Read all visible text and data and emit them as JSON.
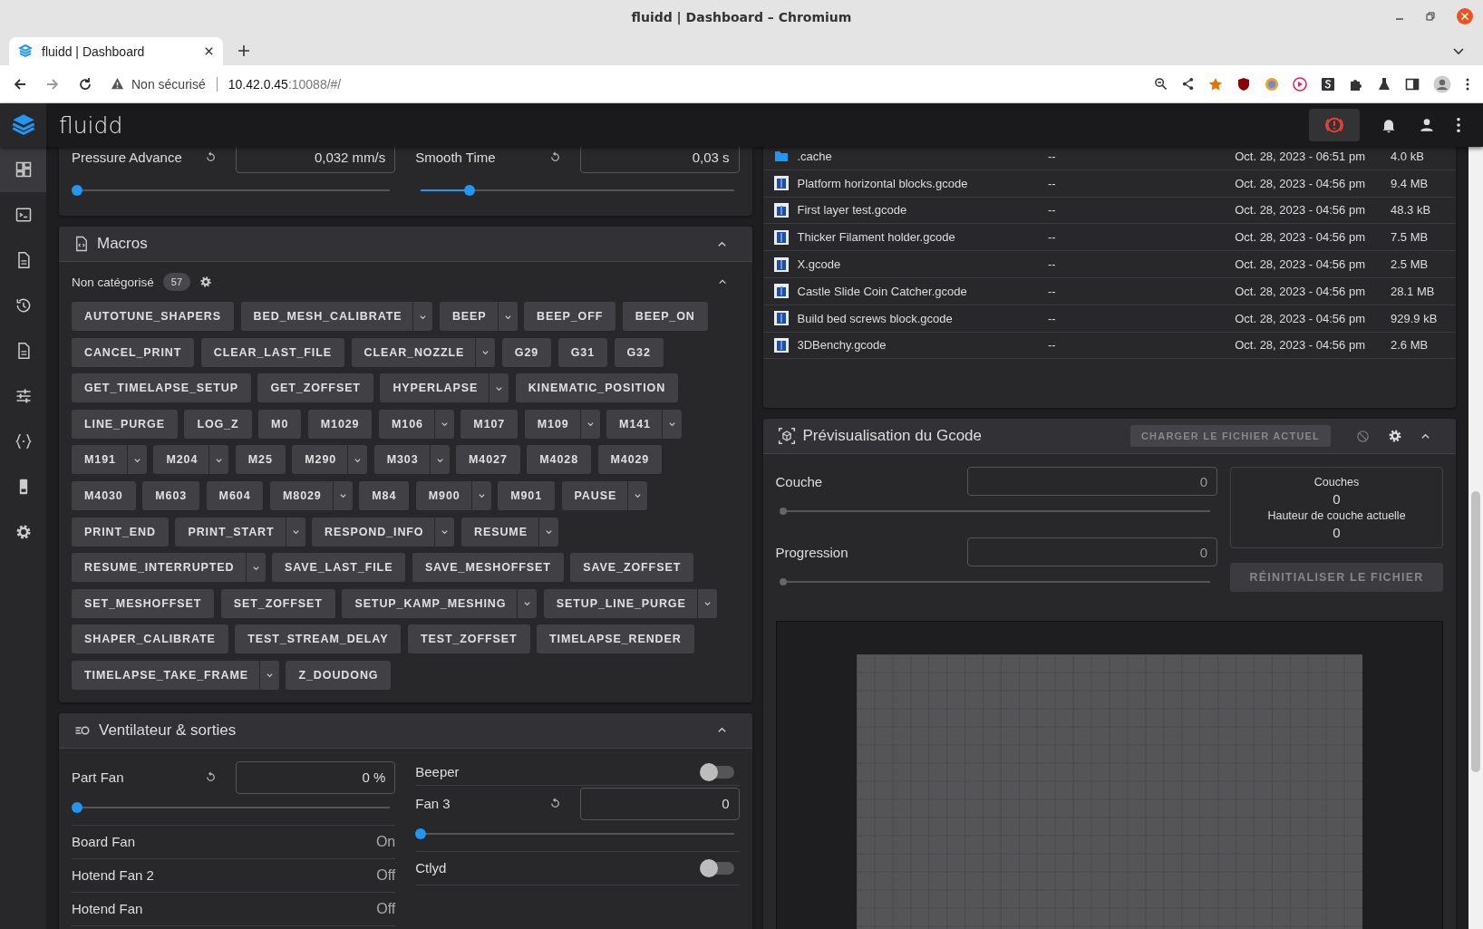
{
  "browser": {
    "window_title": "fluidd | Dashboard – Chromium",
    "tab_title": "fluidd | Dashboard",
    "security_label": "Non sécurisé",
    "url_host": "10.42.0.45",
    "url_rest": ":10088/#/"
  },
  "app": {
    "name": "fluidd"
  },
  "sidebar": {
    "items": [
      {
        "kind": "dashboard",
        "selected": true
      },
      {
        "kind": "console",
        "selected": false
      },
      {
        "kind": "file",
        "selected": false
      },
      {
        "kind": "history",
        "selected": false
      },
      {
        "kind": "document",
        "selected": false
      },
      {
        "kind": "tune",
        "selected": false
      },
      {
        "kind": "braces",
        "selected": false
      },
      {
        "kind": "device",
        "selected": false
      },
      {
        "kind": "settings",
        "selected": false
      }
    ]
  },
  "tuning": [
    {
      "label": "Pressure Advance",
      "value": "0,032 mm/s",
      "level": 0
    },
    {
      "label": "Smooth Time",
      "value": "0,03 s",
      "level": 0.15
    }
  ],
  "macros": {
    "title": "Macros",
    "category": "Non catégorisé",
    "count": "57",
    "items": [
      {
        "name": "AUTOTUNE_SHAPERS",
        "has_menu": false
      },
      {
        "name": "BED_MESH_CALIBRATE",
        "has_menu": true
      },
      {
        "name": "BEEP",
        "has_menu": true
      },
      {
        "name": "BEEP_OFF",
        "has_menu": false
      },
      {
        "name": "BEEP_ON",
        "has_menu": false
      },
      {
        "name": "CANCEL_PRINT",
        "has_menu": false
      },
      {
        "name": "CLEAR_LAST_FILE",
        "has_menu": false
      },
      {
        "name": "CLEAR_NOZZLE",
        "has_menu": true
      },
      {
        "name": "G29",
        "has_menu": false
      },
      {
        "name": "G31",
        "has_menu": false
      },
      {
        "name": "G32",
        "has_menu": false
      },
      {
        "name": "GET_TIMELAPSE_SETUP",
        "has_menu": false
      },
      {
        "name": "GET_ZOFFSET",
        "has_menu": false
      },
      {
        "name": "HYPERLAPSE",
        "has_menu": true
      },
      {
        "name": "KINEMATIC_POSITION",
        "has_menu": false
      },
      {
        "name": "LINE_PURGE",
        "has_menu": false
      },
      {
        "name": "LOG_Z",
        "has_menu": false
      },
      {
        "name": "M0",
        "has_menu": false
      },
      {
        "name": "M1029",
        "has_menu": false
      },
      {
        "name": "M106",
        "has_menu": true
      },
      {
        "name": "M107",
        "has_menu": false
      },
      {
        "name": "M109",
        "has_menu": true
      },
      {
        "name": "M141",
        "has_menu": true
      },
      {
        "name": "M191",
        "has_menu": true
      },
      {
        "name": "M204",
        "has_menu": true
      },
      {
        "name": "M25",
        "has_menu": false
      },
      {
        "name": "M290",
        "has_menu": true
      },
      {
        "name": "M303",
        "has_menu": true
      },
      {
        "name": "M4027",
        "has_menu": false
      },
      {
        "name": "M4028",
        "has_menu": false
      },
      {
        "name": "M4029",
        "has_menu": false
      },
      {
        "name": "M4030",
        "has_menu": false
      },
      {
        "name": "M603",
        "has_menu": false
      },
      {
        "name": "M604",
        "has_menu": false
      },
      {
        "name": "M8029",
        "has_menu": true
      },
      {
        "name": "M84",
        "has_menu": false
      },
      {
        "name": "M900",
        "has_menu": true
      },
      {
        "name": "M901",
        "has_menu": false
      },
      {
        "name": "PAUSE",
        "has_menu": true
      },
      {
        "name": "PRINT_END",
        "has_menu": false
      },
      {
        "name": "PRINT_START",
        "has_menu": true
      },
      {
        "name": "RESPOND_INFO",
        "has_menu": true
      },
      {
        "name": "RESUME",
        "has_menu": true
      },
      {
        "name": "RESUME_INTERRUPTED",
        "has_menu": true
      },
      {
        "name": "SAVE_LAST_FILE",
        "has_menu": false
      },
      {
        "name": "SAVE_MESHOFFSET",
        "has_menu": false
      },
      {
        "name": "SAVE_ZOFFSET",
        "has_menu": false
      },
      {
        "name": "SET_MESHOFFSET",
        "has_menu": false
      },
      {
        "name": "SET_ZOFFSET",
        "has_menu": false
      },
      {
        "name": "SETUP_KAMP_MESHING",
        "has_menu": true
      },
      {
        "name": "SETUP_LINE_PURGE",
        "has_menu": true
      },
      {
        "name": "SHAPER_CALIBRATE",
        "has_menu": false
      },
      {
        "name": "TEST_STREAM_DELAY",
        "has_menu": false
      },
      {
        "name": "TEST_ZOFFSET",
        "has_menu": false
      },
      {
        "name": "TIMELAPSE_RENDER",
        "has_menu": false
      },
      {
        "name": "TIMELAPSE_TAKE_FRAME",
        "has_menu": true
      },
      {
        "name": "Z_DOUDONG",
        "has_menu": false
      }
    ]
  },
  "outputs": {
    "title": "Ventilateur & sorties",
    "left": [
      {
        "kind": "slider",
        "label": "Part Fan",
        "value": "0 %",
        "level": 0
      },
      {
        "kind": "status",
        "label": "Board Fan",
        "value": "On"
      },
      {
        "kind": "status",
        "label": "Hotend Fan 2",
        "value": "Off"
      },
      {
        "kind": "status",
        "label": "Hotend Fan",
        "value": "Off"
      }
    ],
    "right": [
      {
        "kind": "toggle",
        "label": "Beeper",
        "on": false
      },
      {
        "kind": "slider",
        "label": "Fan 3",
        "value": "0",
        "level": 0
      },
      {
        "kind": "toggle",
        "label": "Ctlyd",
        "on": false
      }
    ]
  },
  "files": [
    {
      "kind": "folder",
      "name": ".cache",
      "column_2": "--",
      "modified": "Oct. 28, 2023 - 06:51 pm",
      "size": "4.0 kB"
    },
    {
      "kind": "gcode",
      "name": "Platform horizontal blocks.gcode",
      "column_2": "--",
      "modified": "Oct. 28, 2023 - 04:56 pm",
      "size": "9.4 MB"
    },
    {
      "kind": "gcode",
      "name": "First layer test.gcode",
      "column_2": "--",
      "modified": "Oct. 28, 2023 - 04:56 pm",
      "size": "48.3 kB"
    },
    {
      "kind": "gcode",
      "name": "Thicker Filament holder.gcode",
      "column_2": "--",
      "modified": "Oct. 28, 2023 - 04:56 pm",
      "size": "7.5 MB"
    },
    {
      "kind": "gcode",
      "name": "X.gcode",
      "column_2": "--",
      "modified": "Oct. 28, 2023 - 04:56 pm",
      "size": "2.5 MB"
    },
    {
      "kind": "gcode",
      "name": "Castle Slide Coin Catcher.gcode",
      "column_2": "--",
      "modified": "Oct. 28, 2023 - 04:56 pm",
      "size": "28.1 MB"
    },
    {
      "kind": "gcode",
      "name": "Build bed screws block.gcode",
      "column_2": "--",
      "modified": "Oct. 28, 2023 - 04:56 pm",
      "size": "929.9 kB"
    },
    {
      "kind": "gcode",
      "name": "3DBenchy.gcode",
      "column_2": "--",
      "modified": "Oct. 28, 2023 - 04:56 pm",
      "size": "2.6 MB"
    }
  ],
  "gcode_preview": {
    "title": "Prévisualisation du Gcode",
    "load_button": "CHARGER LE FICHIER ACTUEL",
    "layer": {
      "label": "Couche",
      "value": "0",
      "level": 0
    },
    "progress": {
      "label": "Progression",
      "value": "0",
      "level": 0
    },
    "stats": {
      "layers_label": "Couches",
      "layers_value": "0",
      "height_label": "Hauteur de couche actuelle",
      "height_value": "0"
    },
    "reset_button": "RÉINITIALISER LE FICHIER"
  }
}
